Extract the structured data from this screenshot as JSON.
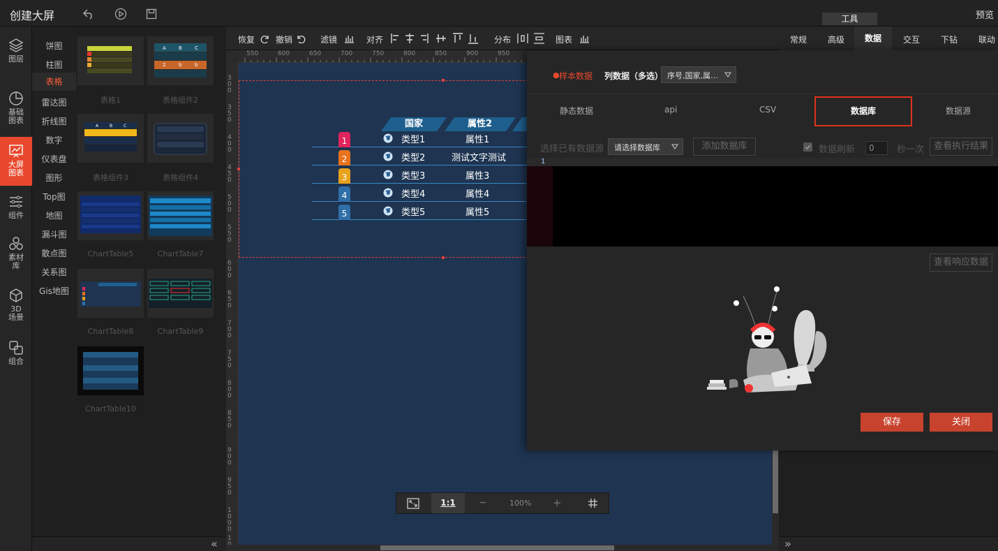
{
  "app": {
    "title": "创建大屏",
    "preview": "预览",
    "tools_tab": "工具"
  },
  "leftnav": [
    {
      "label_lines": [
        "图层"
      ],
      "icon": "layers-icon"
    },
    {
      "label_lines": [
        "基础",
        "图表"
      ],
      "icon": "pie-chart-icon"
    },
    {
      "label_lines": [
        "大屏",
        "图表"
      ],
      "icon": "screen-chart-icon",
      "active": true
    },
    {
      "label_lines": [
        "组件"
      ],
      "icon": "sliders-icon"
    },
    {
      "label_lines": [
        "素材",
        "库"
      ],
      "icon": "material-icon"
    },
    {
      "label_lines": [
        "3D",
        "场景"
      ],
      "icon": "cube-icon"
    },
    {
      "label_lines": [
        "组合"
      ],
      "icon": "combine-icon"
    }
  ],
  "categories": [
    "饼图",
    "柱图",
    "表格",
    "雷达图",
    "折线图",
    "数字",
    "仪表盘",
    "图形",
    "Top图",
    "地图",
    "漏斗图",
    "散点图",
    "关系图",
    "Gis地图"
  ],
  "active_category": "表格",
  "gallery": [
    "表格1",
    "表格组件2",
    "表格组件3",
    "表格组件4",
    "ChartTable5",
    "ChartTable7",
    "ChartTable8",
    "ChartTable9",
    "ChartTable10"
  ],
  "toolbar": {
    "redo": "恢复",
    "undo": "撤销",
    "filter": "滤镜",
    "align": "对齐",
    "distribute": "分布",
    "chart": "图表"
  },
  "ruler_h": [
    "550",
    "600",
    "650",
    "700",
    "750",
    "800",
    "850",
    "900",
    "950"
  ],
  "ruler_v": [
    "300",
    "350",
    "400",
    "450",
    "500",
    "550",
    "600",
    "650",
    "700",
    "750",
    "800",
    "850",
    "900",
    "950",
    "1000",
    "1050"
  ],
  "table_widget": {
    "headers": [
      "国家",
      "属性2"
    ],
    "rows": [
      {
        "rank": "1",
        "col1": "类型1",
        "col2": "属性1",
        "color": "#e0245e"
      },
      {
        "rank": "2",
        "col1": "类型2",
        "col2": "测试文字测试",
        "color": "#e8731c"
      },
      {
        "rank": "3",
        "col1": "类型3",
        "col2": "属性3",
        "color": "#e8a21c"
      },
      {
        "rank": "4",
        "col1": "类型4",
        "col2": "属性4",
        "color": "#2f6fa8"
      },
      {
        "rank": "5",
        "col1": "类型5",
        "col2": "属性5",
        "color": "#2f6fa8"
      }
    ]
  },
  "zoom": {
    "ratio": "1:1",
    "minus": "−",
    "level": "100%",
    "plus": "+"
  },
  "righttabs": [
    "常规",
    "高级",
    "数据",
    "交互",
    "下钻",
    "联动"
  ],
  "active_righttab": "数据",
  "modal": {
    "sample_data": "样本数据",
    "col_data_label": "列数据（多选）",
    "col_data_value": "序号,国家,属…",
    "source_tabs": [
      "静态数据",
      "api",
      "CSV",
      "数据库",
      "数据源"
    ],
    "active_source": "数据库",
    "select_db_label": "选择已有数据源",
    "select_db_placeholder": "请选择数据库",
    "add_db": "添加数据库",
    "refresh_label": "数据刷新",
    "refresh_value": "0",
    "refresh_unit": "秒一次",
    "view_exec": "查看执行结果",
    "line_no": "1",
    "view_resp": "查看响应数据",
    "save": "保存",
    "close": "关闭"
  },
  "colors": {
    "accent": "#e8492e",
    "stage": "#1e3451",
    "highlight_border": "#e0321e"
  }
}
